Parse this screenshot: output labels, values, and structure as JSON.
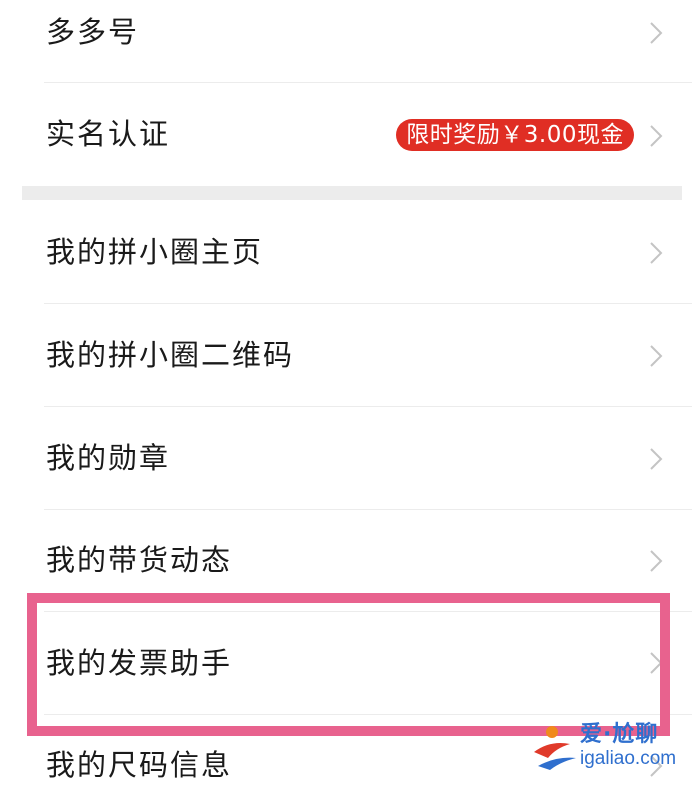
{
  "menu": {
    "items": [
      {
        "label": "多多号"
      },
      {
        "label": "实名认证",
        "badge": "限时奖励￥3.00现金"
      },
      {
        "label": "我的拼小圈主页"
      },
      {
        "label": "我的拼小圈二维码"
      },
      {
        "label": "我的勋章"
      },
      {
        "label": "我的带货动态"
      },
      {
        "label": "我的发票助手"
      },
      {
        "label": "我的尺码信息"
      }
    ]
  },
  "colors": {
    "badge_bg": "#e02e24",
    "highlight_border": "#e8628e",
    "section_gap": "#ececec"
  },
  "watermark": {
    "title": "爱·尬聊",
    "url": "igaliao.com"
  }
}
